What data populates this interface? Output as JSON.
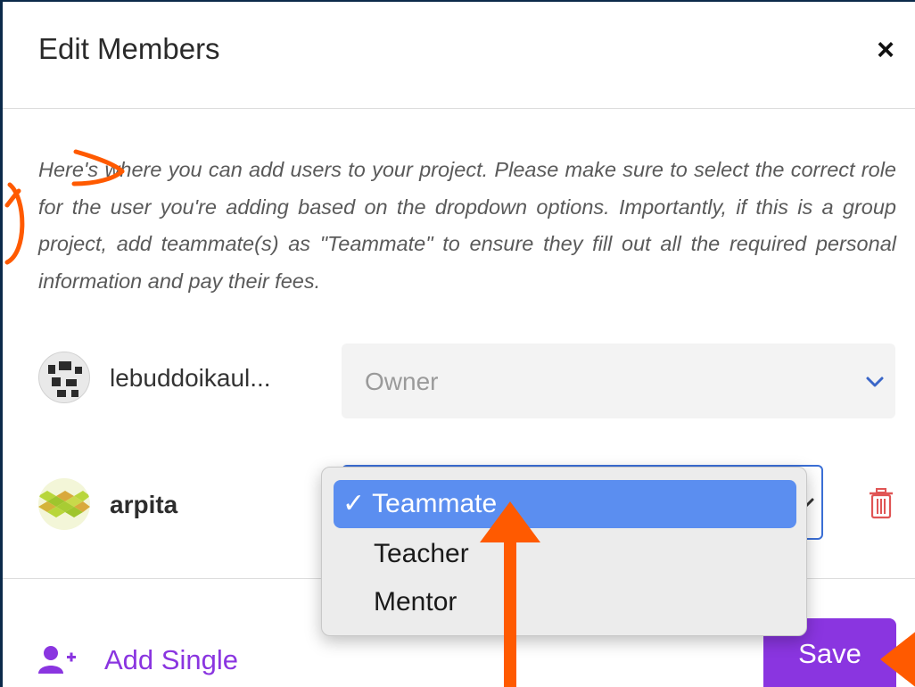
{
  "dialog": {
    "title": "Edit Members",
    "close_glyph": "×",
    "description": "Here's where you can add users to your project. Please make sure to select the correct role for the user you're adding based on the dropdown options. Importantly, if this is a group project, add teammate(s) as \"Teammate\" to ensure they fill out all the required personal information and pay their fees."
  },
  "members": [
    {
      "name": "lebuddoikaul...",
      "role": "Owner"
    },
    {
      "name": "arpita",
      "role": "Teammate"
    }
  ],
  "dropdown": {
    "check_glyph": "✓",
    "options": [
      "Teammate",
      "Teacher",
      "Mentor"
    ],
    "selected": "Teammate"
  },
  "footer": {
    "add_single_label": "Add Single",
    "save_label": "Save"
  },
  "colors": {
    "accent": "#8a35e0",
    "selected_option": "#5b8ef0",
    "annotation": "#ff5a00",
    "delete_icon": "#e05555"
  },
  "icons": [
    "close-icon",
    "chevron-down-icon",
    "trash-icon",
    "add-user-icon",
    "check-icon"
  ]
}
